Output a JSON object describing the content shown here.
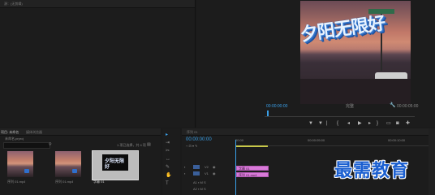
{
  "source": {
    "title": "源：(无剪辑)"
  },
  "program": {
    "title_overlay": "夕阳无限好",
    "timecode": "00:00:00:00",
    "fit": "完整",
    "duration": "00:00:05:00"
  },
  "project": {
    "tab_project": "项目: 未命名",
    "tab_browser": "媒体浏览器",
    "file_name": "未命名.prproj",
    "item_count": "1 项已选择，共 4 项",
    "thumbnails": [
      {
        "label": "序列 01.mp4"
      },
      {
        "label": "序列 01.mp4"
      },
      {
        "label": "字幕 01",
        "preview": "夕阳无限好"
      }
    ]
  },
  "timeline": {
    "title": "序列 01",
    "timecode": "00:00:00:00",
    "ruler": [
      "00:00",
      "00:00:05:00",
      "00:00:10:00"
    ],
    "tracks": [
      {
        "name": "V1",
        "clip": "字幕 01"
      },
      {
        "name": "V2",
        "clip": "序列 01.mp4"
      }
    ]
  },
  "watermark": "最需教育",
  "icons": [
    "wrench-icon",
    "play-icon",
    "step-back-icon",
    "step-forward-icon",
    "mark-in-icon",
    "mark-out-icon",
    "camera-icon",
    "search-icon",
    "selection-tool-icon",
    "razor-tool-icon",
    "pen-tool-icon",
    "hand-tool-icon",
    "type-tool-icon",
    "eye-icon",
    "lock-icon"
  ]
}
